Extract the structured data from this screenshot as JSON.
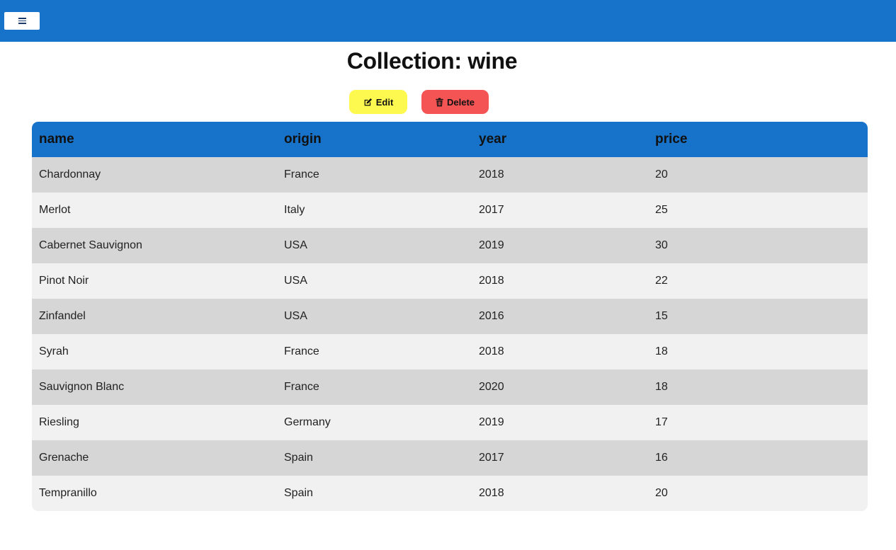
{
  "header": {
    "menu_icon": "hamburger-icon",
    "colors": {
      "bar": "#1773c9"
    }
  },
  "page": {
    "title": "Collection: wine"
  },
  "actions": {
    "edit_label": "Edit",
    "edit_icon": "edit-icon",
    "edit_color": "#fdf94e",
    "delete_label": "Delete",
    "delete_icon": "trash-icon",
    "delete_color": "#f55454"
  },
  "table": {
    "columns": [
      "name",
      "origin",
      "year",
      "price"
    ],
    "rows": [
      [
        "Chardonnay",
        "France",
        "2018",
        "20"
      ],
      [
        "Merlot",
        "Italy",
        "2017",
        "25"
      ],
      [
        "Cabernet Sauvignon",
        "USA",
        "2019",
        "30"
      ],
      [
        "Pinot Noir",
        "USA",
        "2018",
        "22"
      ],
      [
        "Zinfandel",
        "USA",
        "2016",
        "15"
      ],
      [
        "Syrah",
        "France",
        "2018",
        "18"
      ],
      [
        "Sauvignon Blanc",
        "France",
        "2020",
        "18"
      ],
      [
        "Riesling",
        "Germany",
        "2019",
        "17"
      ],
      [
        "Grenache",
        "Spain",
        "2017",
        "16"
      ],
      [
        "Tempranillo",
        "Spain",
        "2018",
        "20"
      ]
    ]
  }
}
